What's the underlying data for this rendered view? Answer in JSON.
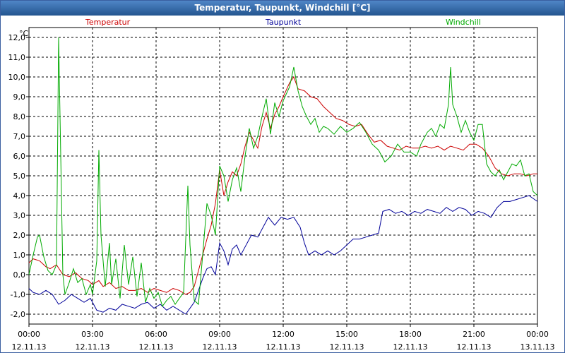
{
  "window": {
    "title": "Temperatur, Taupunkt, Windchill [°C]"
  },
  "colors": {
    "temperatur": "#cc0000",
    "taupunkt": "#000099",
    "windchill": "#00aa00"
  },
  "chart_data": {
    "type": "line",
    "title": "Temperatur, Taupunkt, Windchill [°C]",
    "ylabel": "°C",
    "ylim": [
      -2.5,
      12.5
    ],
    "xlim": [
      0,
      24
    ],
    "grid": true,
    "legend_position": "top",
    "y_ticks": [
      "-2,0",
      "-1,0",
      "0,0",
      "1,0",
      "2,0",
      "3,0",
      "4,0",
      "5,0",
      "6,0",
      "7,0",
      "8,0",
      "9,0",
      "10,0",
      "11,0",
      "12,0"
    ],
    "x_ticks": [
      {
        "time": "00:00",
        "date": "12.11.13"
      },
      {
        "time": "03:00",
        "date": "12.11.13"
      },
      {
        "time": "06:00",
        "date": "12.11.13"
      },
      {
        "time": "09:00",
        "date": "12.11.13"
      },
      {
        "time": "12:00",
        "date": "12.11.13"
      },
      {
        "time": "15:00",
        "date": "12.11.13"
      },
      {
        "time": "18:00",
        "date": "12.11.13"
      },
      {
        "time": "21:00",
        "date": "12.11.13"
      },
      {
        "time": "00:00",
        "date": "13.11.13"
      }
    ],
    "series": [
      {
        "name": "Temperatur",
        "color": "#cc0000",
        "points": [
          [
            0,
            0.6
          ],
          [
            0.2,
            0.8
          ],
          [
            0.5,
            0.7
          ],
          [
            0.8,
            0.4
          ],
          [
            1.0,
            0.3
          ],
          [
            1.3,
            0.5
          ],
          [
            1.6,
            0.0
          ],
          [
            1.9,
            -0.1
          ],
          [
            2.2,
            0.1
          ],
          [
            2.5,
            -0.2
          ],
          [
            2.8,
            -0.3
          ],
          [
            3.0,
            -0.5
          ],
          [
            3.3,
            -0.3
          ],
          [
            3.5,
            -0.6
          ],
          [
            3.8,
            -0.4
          ],
          [
            4.1,
            -0.7
          ],
          [
            4.4,
            -0.6
          ],
          [
            4.7,
            -0.8
          ],
          [
            5.0,
            -0.8
          ],
          [
            5.3,
            -0.7
          ],
          [
            5.6,
            -0.9
          ],
          [
            5.9,
            -0.7
          ],
          [
            6.2,
            -0.8
          ],
          [
            6.5,
            -0.9
          ],
          [
            6.8,
            -0.7
          ],
          [
            7.1,
            -0.8
          ],
          [
            7.4,
            -1.0
          ],
          [
            7.6,
            -0.9
          ],
          [
            7.8,
            -0.6
          ],
          [
            8.0,
            0.2
          ],
          [
            8.2,
            1.0
          ],
          [
            8.4,
            1.8
          ],
          [
            8.6,
            2.5
          ],
          [
            8.8,
            3.6
          ],
          [
            9.0,
            5.3
          ],
          [
            9.2,
            4.0
          ],
          [
            9.4,
            4.7
          ],
          [
            9.6,
            5.2
          ],
          [
            9.8,
            5.0
          ],
          [
            10.0,
            5.6
          ],
          [
            10.2,
            6.5
          ],
          [
            10.4,
            7.2
          ],
          [
            10.6,
            6.8
          ],
          [
            10.8,
            6.4
          ],
          [
            11.0,
            7.5
          ],
          [
            11.2,
            8.2
          ],
          [
            11.4,
            7.4
          ],
          [
            11.6,
            8.1
          ],
          [
            11.8,
            8.5
          ],
          [
            12.0,
            9.0
          ],
          [
            12.3,
            9.7
          ],
          [
            12.5,
            10.0
          ],
          [
            12.7,
            9.4
          ],
          [
            13.0,
            9.3
          ],
          [
            13.3,
            9.0
          ],
          [
            13.6,
            8.9
          ],
          [
            13.9,
            8.5
          ],
          [
            14.2,
            8.2
          ],
          [
            14.5,
            7.9
          ],
          [
            14.8,
            7.8
          ],
          [
            15.1,
            7.6
          ],
          [
            15.4,
            7.5
          ],
          [
            15.7,
            7.6
          ],
          [
            16.0,
            7.1
          ],
          [
            16.3,
            6.7
          ],
          [
            16.6,
            6.8
          ],
          [
            16.9,
            6.5
          ],
          [
            17.2,
            6.4
          ],
          [
            17.5,
            6.3
          ],
          [
            17.8,
            6.5
          ],
          [
            18.1,
            6.4
          ],
          [
            18.4,
            6.4
          ],
          [
            18.7,
            6.5
          ],
          [
            19.0,
            6.4
          ],
          [
            19.3,
            6.5
          ],
          [
            19.6,
            6.3
          ],
          [
            19.9,
            6.5
          ],
          [
            20.2,
            6.4
          ],
          [
            20.5,
            6.3
          ],
          [
            20.8,
            6.6
          ],
          [
            21.1,
            6.6
          ],
          [
            21.4,
            6.4
          ],
          [
            21.7,
            6.0
          ],
          [
            22.0,
            5.4
          ],
          [
            22.3,
            5.1
          ],
          [
            22.6,
            5.0
          ],
          [
            22.9,
            5.1
          ],
          [
            23.2,
            5.1
          ],
          [
            23.5,
            5.0
          ],
          [
            23.8,
            5.1
          ],
          [
            24,
            5.1
          ]
        ]
      },
      {
        "name": "Taupunkt",
        "color": "#000099",
        "points": [
          [
            0,
            -0.7
          ],
          [
            0.2,
            -0.9
          ],
          [
            0.5,
            -1.0
          ],
          [
            0.8,
            -0.8
          ],
          [
            1.1,
            -1.0
          ],
          [
            1.4,
            -1.5
          ],
          [
            1.7,
            -1.3
          ],
          [
            2.0,
            -1.0
          ],
          [
            2.3,
            -1.2
          ],
          [
            2.6,
            -1.4
          ],
          [
            2.9,
            -1.2
          ],
          [
            3.2,
            -1.8
          ],
          [
            3.5,
            -1.9
          ],
          [
            3.8,
            -1.7
          ],
          [
            4.1,
            -1.8
          ],
          [
            4.4,
            -1.5
          ],
          [
            4.7,
            -1.6
          ],
          [
            5.0,
            -1.7
          ],
          [
            5.3,
            -1.5
          ],
          [
            5.6,
            -1.4
          ],
          [
            5.9,
            -1.7
          ],
          [
            6.2,
            -1.5
          ],
          [
            6.5,
            -1.8
          ],
          [
            6.8,
            -1.6
          ],
          [
            7.1,
            -1.8
          ],
          [
            7.4,
            -2.0
          ],
          [
            7.6,
            -1.7
          ],
          [
            7.8,
            -1.4
          ],
          [
            8.0,
            -0.8
          ],
          [
            8.2,
            -0.2
          ],
          [
            8.4,
            0.3
          ],
          [
            8.6,
            0.4
          ],
          [
            8.8,
            0.0
          ],
          [
            9.0,
            1.6
          ],
          [
            9.2,
            1.2
          ],
          [
            9.4,
            0.5
          ],
          [
            9.6,
            1.3
          ],
          [
            9.8,
            1.5
          ],
          [
            10.0,
            1.0
          ],
          [
            10.2,
            1.4
          ],
          [
            10.5,
            2.0
          ],
          [
            10.8,
            1.9
          ],
          [
            11.1,
            2.5
          ],
          [
            11.3,
            2.9
          ],
          [
            11.6,
            2.5
          ],
          [
            11.9,
            2.9
          ],
          [
            12.2,
            2.8
          ],
          [
            12.5,
            2.9
          ],
          [
            12.8,
            2.4
          ],
          [
            13.0,
            1.6
          ],
          [
            13.2,
            1.0
          ],
          [
            13.5,
            1.2
          ],
          [
            13.8,
            1.0
          ],
          [
            14.1,
            1.2
          ],
          [
            14.4,
            1.0
          ],
          [
            14.7,
            1.2
          ],
          [
            15.0,
            1.5
          ],
          [
            15.3,
            1.8
          ],
          [
            15.6,
            1.8
          ],
          [
            15.9,
            1.9
          ],
          [
            16.2,
            2.0
          ],
          [
            16.5,
            2.1
          ],
          [
            16.7,
            3.2
          ],
          [
            17.0,
            3.3
          ],
          [
            17.3,
            3.1
          ],
          [
            17.6,
            3.2
          ],
          [
            17.9,
            3.0
          ],
          [
            18.2,
            3.2
          ],
          [
            18.5,
            3.1
          ],
          [
            18.8,
            3.3
          ],
          [
            19.1,
            3.2
          ],
          [
            19.4,
            3.1
          ],
          [
            19.7,
            3.4
          ],
          [
            20.0,
            3.2
          ],
          [
            20.3,
            3.4
          ],
          [
            20.6,
            3.3
          ],
          [
            20.9,
            3.0
          ],
          [
            21.2,
            3.2
          ],
          [
            21.5,
            3.1
          ],
          [
            21.8,
            2.9
          ],
          [
            22.1,
            3.4
          ],
          [
            22.4,
            3.7
          ],
          [
            22.7,
            3.7
          ],
          [
            23.0,
            3.8
          ],
          [
            23.3,
            3.9
          ],
          [
            23.6,
            4.0
          ],
          [
            24,
            3.7
          ]
        ]
      },
      {
        "name": "Windchill",
        "color": "#00aa00",
        "points": [
          [
            0,
            0.0
          ],
          [
            0.2,
            1.0
          ],
          [
            0.4,
            1.9
          ],
          [
            0.5,
            2.0
          ],
          [
            0.7,
            0.9
          ],
          [
            0.9,
            0.2
          ],
          [
            1.1,
            0.0
          ],
          [
            1.3,
            0.5
          ],
          [
            1.4,
            12.0
          ],
          [
            1.5,
            6.0
          ],
          [
            1.6,
            0.0
          ],
          [
            1.7,
            -1.0
          ],
          [
            1.9,
            -0.4
          ],
          [
            2.1,
            0.3
          ],
          [
            2.3,
            -0.4
          ],
          [
            2.5,
            -0.2
          ],
          [
            2.7,
            -1.0
          ],
          [
            2.9,
            -0.5
          ],
          [
            3.0,
            -1.0
          ],
          [
            3.2,
            0.7
          ],
          [
            3.3,
            6.3
          ],
          [
            3.4,
            2.0
          ],
          [
            3.6,
            -0.6
          ],
          [
            3.8,
            1.6
          ],
          [
            3.9,
            -0.5
          ],
          [
            4.1,
            0.8
          ],
          [
            4.3,
            -1.2
          ],
          [
            4.5,
            1.5
          ],
          [
            4.7,
            -0.5
          ],
          [
            4.9,
            0.9
          ],
          [
            5.1,
            -1.1
          ],
          [
            5.3,
            0.6
          ],
          [
            5.5,
            -1.4
          ],
          [
            5.7,
            -0.7
          ],
          [
            5.9,
            -1.2
          ],
          [
            6.1,
            -0.9
          ],
          [
            6.3,
            -1.6
          ],
          [
            6.5,
            -1.3
          ],
          [
            6.7,
            -1.1
          ],
          [
            6.9,
            -1.5
          ],
          [
            7.1,
            -1.2
          ],
          [
            7.3,
            -0.9
          ],
          [
            7.5,
            4.5
          ],
          [
            7.6,
            1.5
          ],
          [
            7.8,
            -1.3
          ],
          [
            8.0,
            -1.5
          ],
          [
            8.2,
            1.0
          ],
          [
            8.4,
            3.6
          ],
          [
            8.6,
            3.0
          ],
          [
            8.8,
            2.0
          ],
          [
            9.0,
            5.5
          ],
          [
            9.2,
            5.0
          ],
          [
            9.4,
            3.7
          ],
          [
            9.6,
            4.8
          ],
          [
            9.8,
            5.4
          ],
          [
            10.0,
            4.2
          ],
          [
            10.2,
            6.0
          ],
          [
            10.4,
            7.4
          ],
          [
            10.6,
            6.4
          ],
          [
            10.8,
            7.0
          ],
          [
            11.0,
            8.0
          ],
          [
            11.2,
            8.9
          ],
          [
            11.4,
            7.1
          ],
          [
            11.6,
            8.7
          ],
          [
            11.8,
            8.0
          ],
          [
            12.0,
            8.8
          ],
          [
            12.3,
            9.5
          ],
          [
            12.5,
            10.5
          ],
          [
            12.7,
            9.3
          ],
          [
            12.9,
            8.5
          ],
          [
            13.1,
            8.0
          ],
          [
            13.3,
            7.6
          ],
          [
            13.5,
            7.9
          ],
          [
            13.7,
            7.2
          ],
          [
            13.9,
            7.5
          ],
          [
            14.1,
            7.4
          ],
          [
            14.4,
            7.1
          ],
          [
            14.7,
            7.5
          ],
          [
            15.0,
            7.2
          ],
          [
            15.3,
            7.4
          ],
          [
            15.6,
            7.7
          ],
          [
            15.9,
            7.2
          ],
          [
            16.2,
            6.6
          ],
          [
            16.5,
            6.3
          ],
          [
            16.8,
            5.7
          ],
          [
            17.1,
            6.0
          ],
          [
            17.4,
            6.6
          ],
          [
            17.7,
            6.2
          ],
          [
            18.0,
            6.2
          ],
          [
            18.3,
            6.0
          ],
          [
            18.5,
            6.6
          ],
          [
            18.8,
            7.2
          ],
          [
            19.0,
            7.4
          ],
          [
            19.2,
            7.0
          ],
          [
            19.4,
            7.6
          ],
          [
            19.6,
            7.4
          ],
          [
            19.8,
            8.6
          ],
          [
            19.9,
            10.5
          ],
          [
            20.0,
            8.6
          ],
          [
            20.2,
            8.0
          ],
          [
            20.4,
            7.2
          ],
          [
            20.6,
            7.8
          ],
          [
            20.8,
            7.2
          ],
          [
            21.0,
            6.8
          ],
          [
            21.2,
            7.6
          ],
          [
            21.4,
            7.6
          ],
          [
            21.6,
            5.6
          ],
          [
            21.8,
            5.2
          ],
          [
            22.0,
            5.0
          ],
          [
            22.2,
            5.3
          ],
          [
            22.4,
            4.8
          ],
          [
            22.6,
            5.2
          ],
          [
            22.8,
            5.6
          ],
          [
            23.0,
            5.5
          ],
          [
            23.2,
            5.8
          ],
          [
            23.4,
            5.0
          ],
          [
            23.6,
            5.1
          ],
          [
            23.8,
            4.2
          ],
          [
            24,
            4.0
          ]
        ]
      }
    ]
  }
}
